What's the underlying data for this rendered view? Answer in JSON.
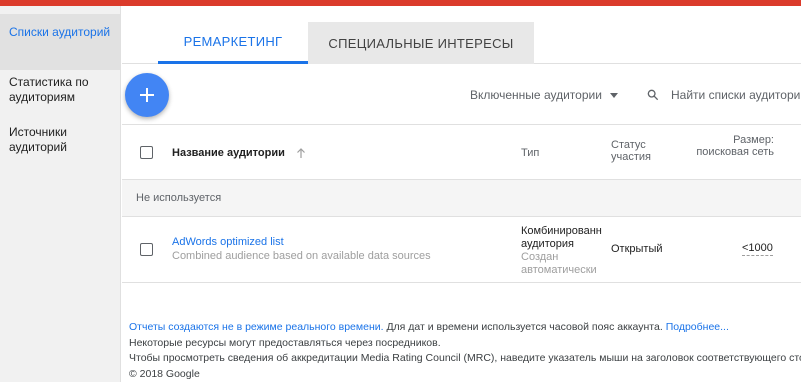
{
  "colors": {
    "accent": "#1a73e8",
    "brand_bar": "#db3b2b",
    "fab": "#4285f4"
  },
  "sidebar": {
    "items": [
      {
        "label": "Списки аудиторий"
      },
      {
        "label": "Статистика по аудиториям"
      },
      {
        "label": "Источники аудиторий"
      }
    ]
  },
  "tabs": [
    {
      "label": "РЕМАРКЕТИНГ"
    },
    {
      "label": "СПЕЦИАЛЬНЫЕ ИНТЕРЕСЫ"
    }
  ],
  "toolbar": {
    "add_icon": "plus-icon",
    "filter_label": "Включенные аудитории",
    "search_placeholder": "Найти списки аудиторий"
  },
  "table": {
    "columns": {
      "name": "Название аудитории",
      "type": "Тип",
      "status": "Статус участия",
      "size": "Размер: поисковая сеть"
    },
    "group_label": "Не используется",
    "rows": [
      {
        "name": "AdWords optimized list",
        "description": "Combined audience based on available data sources",
        "type": "Комбинированн аудитория",
        "type_sub": "Создан автоматически",
        "status": "Открытый",
        "size": "<1000"
      }
    ]
  },
  "footer": {
    "line1_link": "Отчеты создаются не в режиме реального времени.",
    "line1_text": " Для дат и времени используется часовой пояс аккаунта. ",
    "line1_more": "Подробнее...",
    "line2": "Некоторые ресурсы могут предоставляться через посредников.",
    "line3": "Чтобы просмотреть сведения об аккредитации Media Rating Council (MRC), наведите указатель мыши на заголовок соответствующего столбца.",
    "copyright": "© 2018 Google"
  }
}
